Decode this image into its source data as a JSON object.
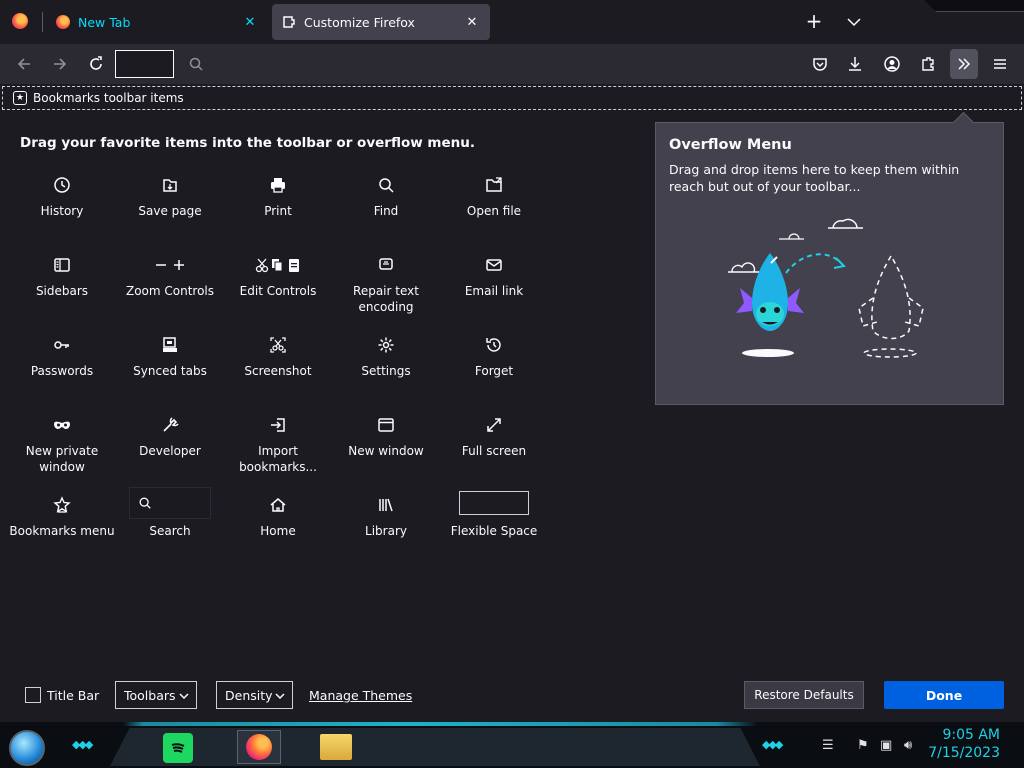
{
  "tabs": [
    {
      "label": "New Tab",
      "icon": "firefox-icon"
    },
    {
      "label": "Customize Firefox",
      "icon": "puzzle-icon"
    }
  ],
  "bookmarks_toolbar": {
    "label": "Bookmarks toolbar items"
  },
  "palette": {
    "instructions": "Drag your favorite items into the toolbar or overflow menu.",
    "items": [
      {
        "label": "History",
        "icon": "clock-icon"
      },
      {
        "label": "Save page",
        "icon": "save-page-icon"
      },
      {
        "label": "Print",
        "icon": "printer-icon"
      },
      {
        "label": "Find",
        "icon": "magnifier-icon"
      },
      {
        "label": "Open file",
        "icon": "open-file-icon"
      },
      {
        "label": "Sidebars",
        "icon": "sidebar-icon"
      },
      {
        "label": "Zoom Controls",
        "icon": "zoom-icon"
      },
      {
        "label": "Edit Controls",
        "icon": "edit-icon"
      },
      {
        "label": "Repair text encoding",
        "icon": "text-encoding-icon"
      },
      {
        "label": "Email link",
        "icon": "envelope-icon"
      },
      {
        "label": "Passwords",
        "icon": "key-icon"
      },
      {
        "label": "Synced tabs",
        "icon": "synced-tabs-icon"
      },
      {
        "label": "Screenshot",
        "icon": "screenshot-icon"
      },
      {
        "label": "Settings",
        "icon": "gear-icon"
      },
      {
        "label": "Forget",
        "icon": "forget-icon"
      },
      {
        "label": "New private window",
        "icon": "mask-icon"
      },
      {
        "label": "Developer",
        "icon": "wrench-icon"
      },
      {
        "label": "Import bookmarks...",
        "icon": "import-icon"
      },
      {
        "label": "New window",
        "icon": "window-icon"
      },
      {
        "label": "Full screen",
        "icon": "fullscreen-icon"
      },
      {
        "label": "Bookmarks menu",
        "icon": "star-icon"
      },
      {
        "label": "Search",
        "icon": "search-box-icon"
      },
      {
        "label": "Home",
        "icon": "home-icon"
      },
      {
        "label": "Library",
        "icon": "library-icon"
      },
      {
        "label": "Flexible Space",
        "icon": "flexible-space"
      }
    ]
  },
  "overflow_menu": {
    "title": "Overflow Menu",
    "description": "Drag and drop items here to keep them within reach but out of your toolbar..."
  },
  "bottom": {
    "title_bar_label": "Title Bar",
    "toolbars_label": "Toolbars",
    "density_label": "Density",
    "manage_themes_label": "Manage Themes",
    "restore_label": "Restore Defaults",
    "done_label": "Done"
  },
  "taskbar": {
    "time": "9:05 AM",
    "date": "7/15/2023"
  },
  "colors": {
    "accent": "#0061e0",
    "new_tab_text": "#00ddff",
    "background": "#1c1b22",
    "panel": "#42414d"
  }
}
